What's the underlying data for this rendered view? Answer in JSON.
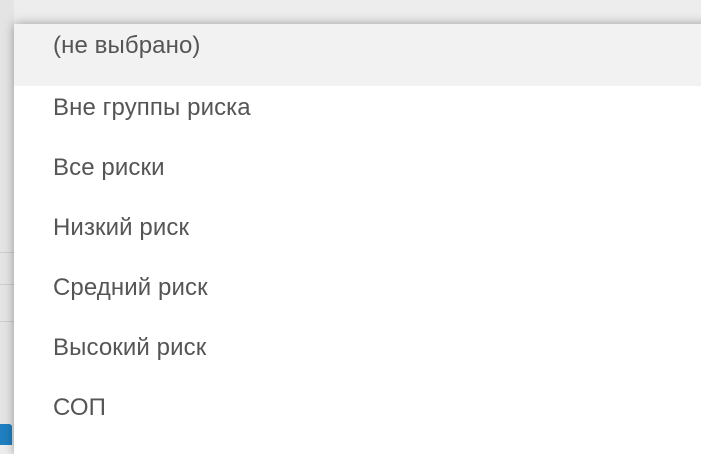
{
  "dropdown": {
    "options": [
      {
        "label": "(не выбрано)",
        "selected": true
      },
      {
        "label": "Вне группы риска",
        "selected": false
      },
      {
        "label": "Все риски",
        "selected": false
      },
      {
        "label": "Низкий риск",
        "selected": false
      },
      {
        "label": "Средний риск",
        "selected": false
      },
      {
        "label": "Высокий риск",
        "selected": false
      },
      {
        "label": "СОП",
        "selected": false
      }
    ]
  },
  "colors": {
    "highlight": "#f2f2f2",
    "text": "#555555",
    "accent": "#1f7fc0"
  }
}
